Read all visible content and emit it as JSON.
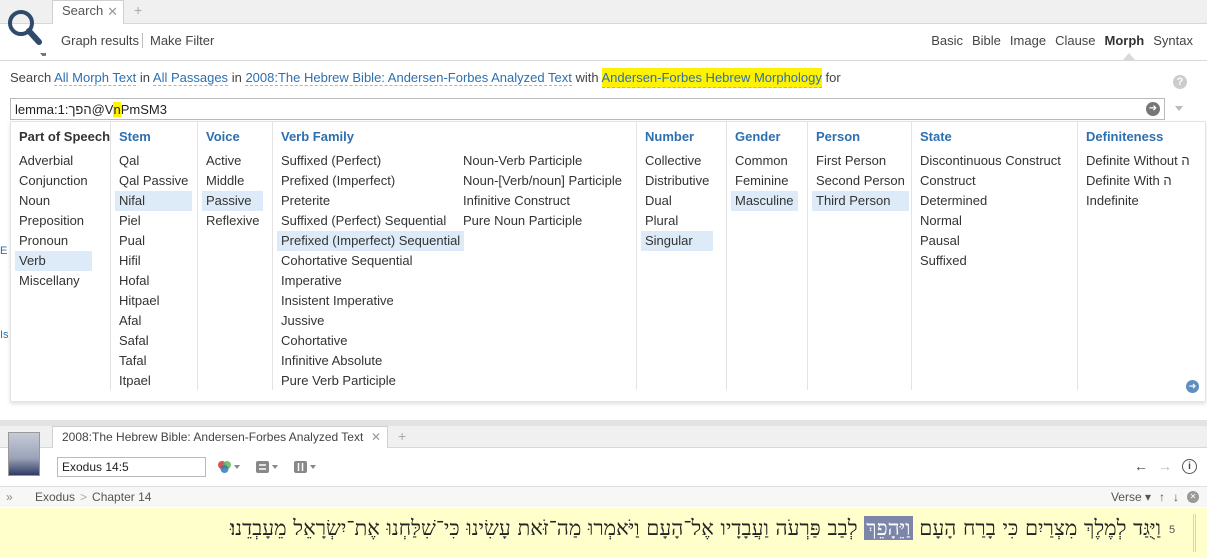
{
  "search_panel": {
    "tab_label": "Search",
    "toolbar": {
      "graph_results": "Graph results",
      "make_filter": "Make Filter",
      "modes": [
        "Basic",
        "Bible",
        "Image",
        "Clause",
        "Morph",
        "Syntax"
      ],
      "active_mode": "Morph"
    },
    "search_line": {
      "prefix": "Search",
      "scope": "All Morph Text",
      "in1": "in",
      "passages": "All Passages",
      "in2": "in",
      "resource": "2008:The Hebrew Bible: Andersen-Forbes Analyzed Text",
      "with": "with",
      "morphology": "Andersen-Forbes Hebrew Morphology",
      "for": "for"
    },
    "query": {
      "before": "lemma:1:הפך@V",
      "highlight": "n",
      "after": "PmSM3"
    },
    "columns": [
      {
        "header": "Part of Speech",
        "options": [
          "Adverbial",
          "Conjunction",
          "Noun",
          "Preposition",
          "Pronoun",
          "Verb",
          "Miscellany"
        ],
        "selected": [
          5
        ]
      },
      {
        "header": "Stem",
        "options": [
          "Qal",
          "Qal Passive",
          "Nifal",
          "Piel",
          "Pual",
          "Hifil",
          "Hofal",
          "Hitpael",
          "Afal",
          "Safal",
          "Tafal",
          "Itpael"
        ],
        "selected": [
          2
        ]
      },
      {
        "header": "Voice",
        "options": [
          "Active",
          "Middle",
          "Passive",
          "Reflexive"
        ],
        "selected": [
          2
        ]
      },
      {
        "header": "Verb Family",
        "options": [
          "Suffixed (Perfect)",
          "Prefixed (Imperfect)",
          "Preterite",
          "Suffixed (Perfect) Sequential",
          "Prefixed (Imperfect) Sequential",
          "Cohortative Sequential",
          "Imperative",
          "Insistent Imperative",
          "Jussive",
          "Cohortative",
          "Infinitive Absolute",
          "Pure Verb Participle"
        ],
        "selected": [
          4
        ]
      },
      {
        "header": "",
        "options": [
          "Noun-Verb Participle",
          "Noun-[Verb/noun] Participle",
          "Infinitive Construct",
          "Pure Noun Participle"
        ],
        "selected": []
      },
      {
        "header": "Number",
        "options": [
          "Collective",
          "Distributive",
          "Dual",
          "Plural",
          "Singular"
        ],
        "selected": [
          4
        ]
      },
      {
        "header": "Gender",
        "options": [
          "Common",
          "Feminine",
          "Masculine"
        ],
        "selected": [
          2
        ]
      },
      {
        "header": "Person",
        "options": [
          "First Person",
          "Second Person",
          "Third Person"
        ],
        "selected": [
          2
        ]
      },
      {
        "header": "State",
        "options": [
          "Discontinuous Construct",
          "Construct",
          "Determined",
          "Normal",
          "Pausal",
          "Suffixed"
        ],
        "selected": []
      },
      {
        "header": "Definiteness",
        "options": [
          "Definite Without ה",
          "Definite With ה",
          "Indefinite"
        ],
        "selected": []
      }
    ],
    "left_edge_marks": [
      "E",
      "Is"
    ]
  },
  "bible_panel": {
    "tab_label": "2008:The Hebrew Bible: Andersen-Forbes Analyzed Text",
    "reference": "Exodus 14:5",
    "breadcrumb": [
      "Exodus",
      "Chapter 14"
    ],
    "verse_dropdown": "Verse",
    "verse_number": "5",
    "verse_before": "וַיֻּגַּד לְמֶלֶךְ מִצְרַיִם כִּי בָרַח הָעָם",
    "verse_highlight": "וַיֵּהָפֵךְ",
    "verse_after": "לְבַב פַּרְעֹה וַעֲבָדָיו אֶל־הָעָם וַיֹּאמְרוּ מַה־זֹּאת עָשִׂינוּ כִּי־שִׁלַּחְנוּ אֶת־יִשְׂרָאֵל מֵעָבְדֵנוּ׃"
  },
  "colors": {
    "link": "#2d6fb0",
    "selection": "#dcebf7",
    "query_highlight": "#fff200",
    "verse_background": "#ffffcc",
    "word_highlight": "#7c86a8"
  }
}
